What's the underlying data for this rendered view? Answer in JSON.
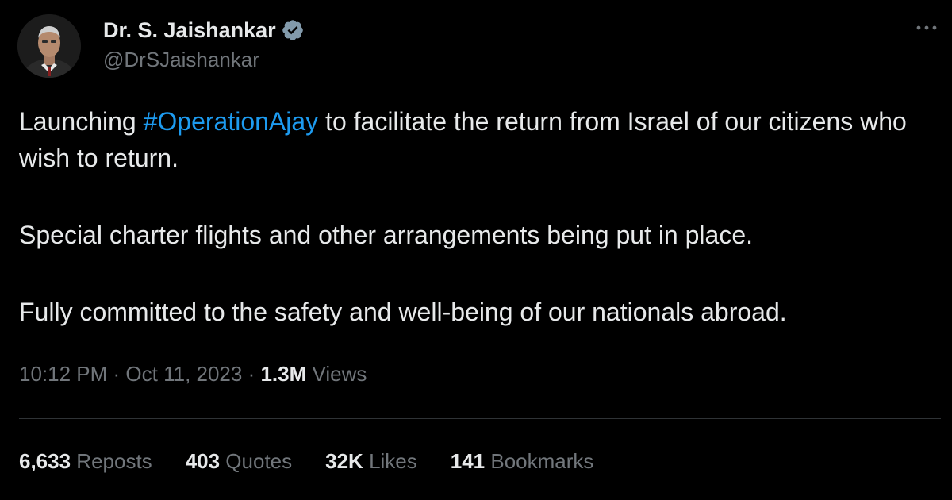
{
  "author": {
    "display_name": "Dr. S. Jaishankar",
    "handle": "@DrSJaishankar",
    "verified": true,
    "verified_color": "#829aab"
  },
  "tweet": {
    "para1_before": "Launching ",
    "hashtag": "#OperationAjay",
    "para1_after": " to facilitate the return from Israel of our citizens who wish to return.",
    "para2": "Special charter flights and other arrangements being put in place.",
    "para3": "Fully committed to the safety and well-being of our nationals abroad."
  },
  "meta": {
    "time": "10:12 PM",
    "separator": " · ",
    "date": "Oct 11, 2023",
    "views_count": "1.3M",
    "views_label": " Views"
  },
  "stats": {
    "reposts_count": "6,633",
    "reposts_label": " Reposts",
    "quotes_count": "403",
    "quotes_label": " Quotes",
    "likes_count": "32K",
    "likes_label": " Likes",
    "bookmarks_count": "141",
    "bookmarks_label": " Bookmarks"
  },
  "icons": {
    "more": "more-options-icon",
    "verified": "verified-badge-icon"
  },
  "colors": {
    "background": "#000000",
    "text": "#e7e9ea",
    "secondary": "#71767b",
    "link": "#1d9bf0",
    "divider": "#2f3336"
  }
}
